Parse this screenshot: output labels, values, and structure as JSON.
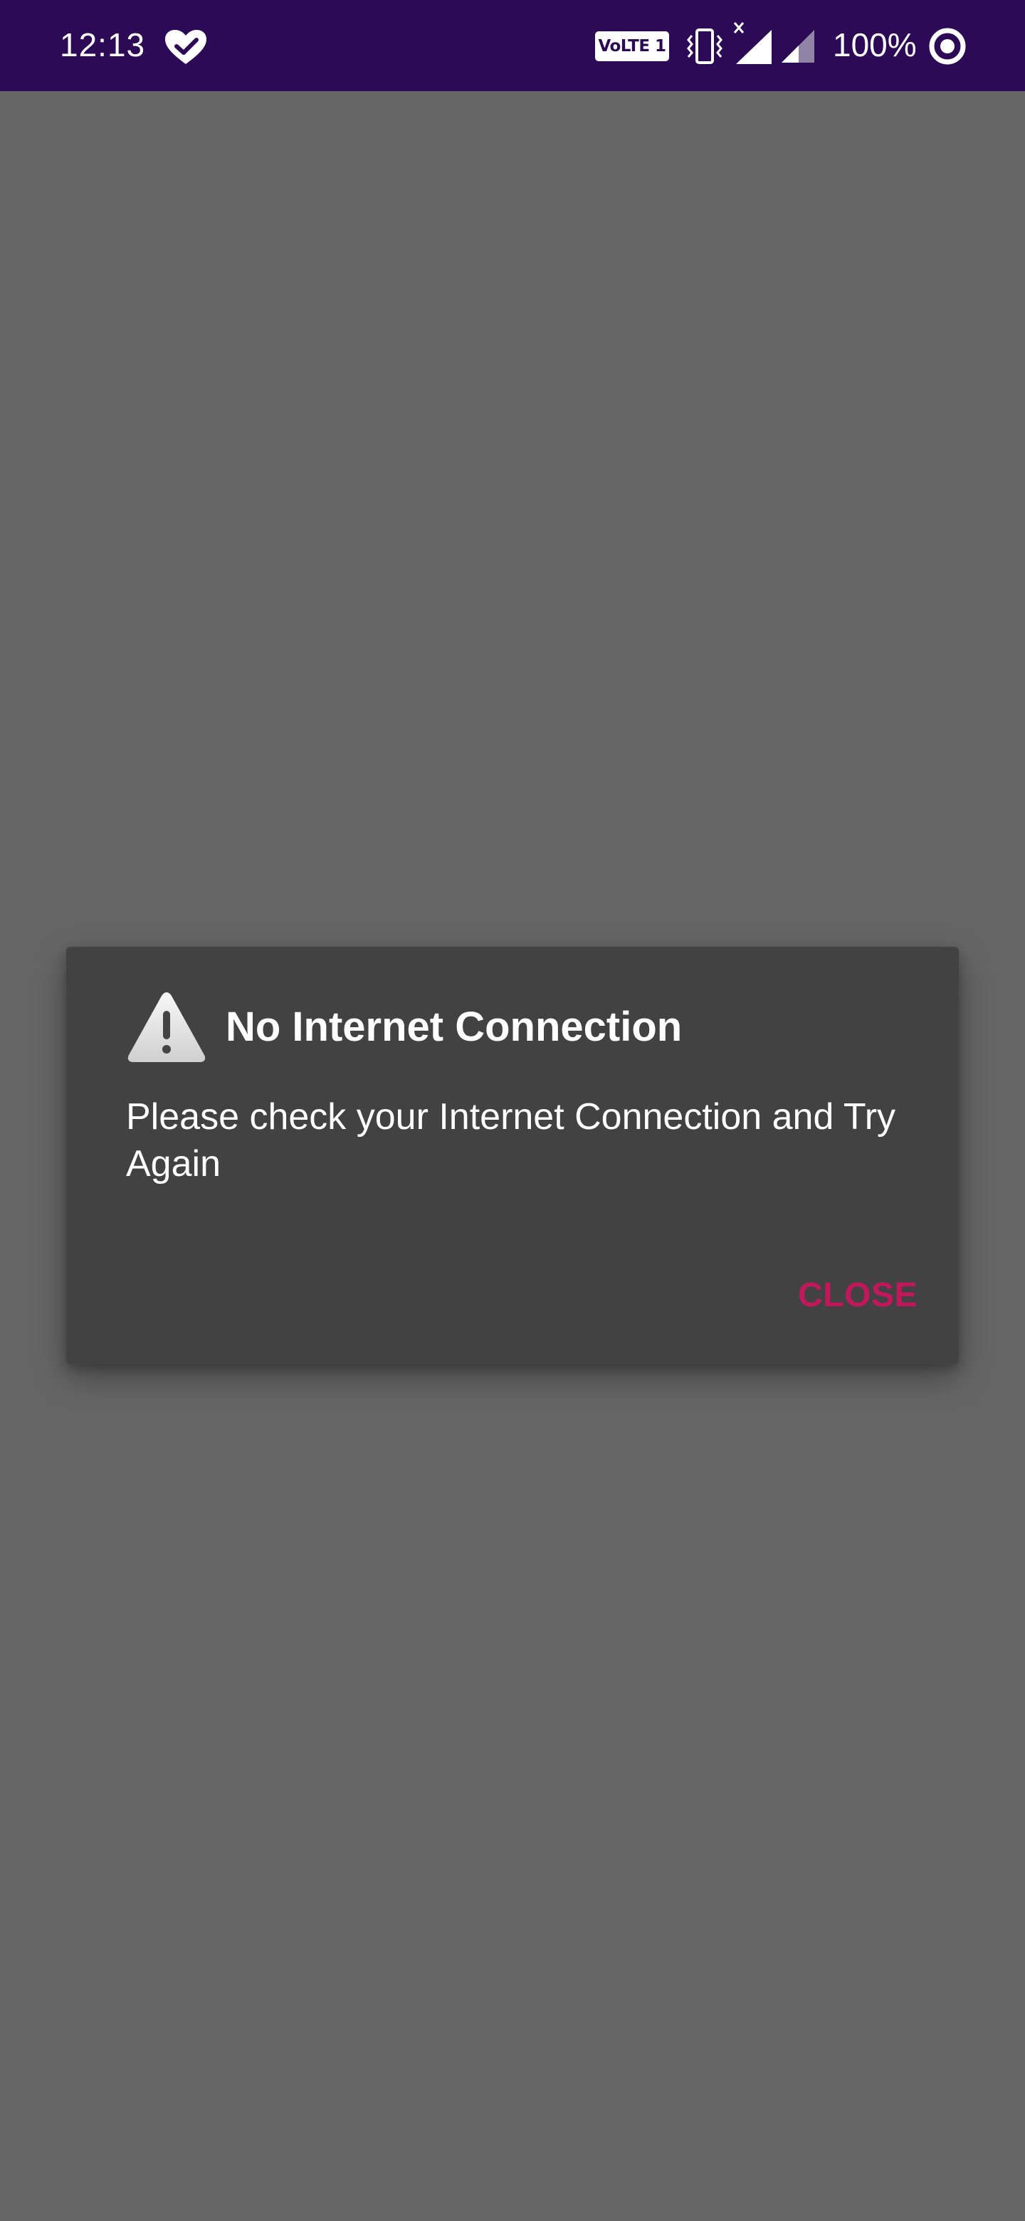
{
  "status_bar": {
    "time": "12:13",
    "network_badge": "VoLTE 1",
    "battery_percent": "100%",
    "icons": [
      "heart-check-icon",
      "volte-icon",
      "vibrate-icon",
      "signal-x-icon",
      "signal-icon",
      "battery-ring-icon"
    ],
    "background_color": "#2d0a55"
  },
  "dialog": {
    "icon": "warning-icon",
    "title": "No Internet Connection",
    "message": "Please check your Internet Connection and Try Again",
    "close_label": "CLOSE",
    "accent_color": "#c2185b",
    "background_color": "#424242"
  },
  "screen": {
    "scrim_color": "#666666"
  }
}
